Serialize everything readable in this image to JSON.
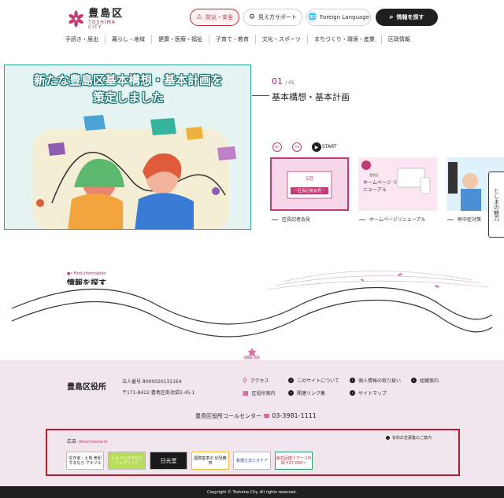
{
  "header": {
    "logo_jp": "豊島区",
    "logo_en": "TOSHIMA CITY",
    "buttons": {
      "disaster": "防災・安全",
      "support": "見え方サポート",
      "language": "Foreign Language",
      "find": "情報を探す"
    },
    "nav": [
      "手続き・届出",
      "暮らし・地域",
      "健康・医療・福祉",
      "子育て・教育",
      "文化・スポーツ",
      "まちづくり・環境・産業",
      "区政情報"
    ]
  },
  "hero": {
    "title_line1": "新たな豊島区基本構想・基本計画を",
    "title_line2": "策定しました",
    "slide_current": "01",
    "slide_total": "/ 05",
    "slide_title": "基本構想・基本計画",
    "start_label": "START"
  },
  "thumbnails": [
    {
      "caption": "区長記者会見",
      "text_top": "5月",
      "text_bottom": "ー区長記者会見ー"
    },
    {
      "caption": "ホームページリニューアル",
      "text_top": "豊島区",
      "text_bottom": "ホームページ リニューアル"
    },
    {
      "caption": "熱中症対策",
      "text_top": "",
      "text_bottom": ""
    }
  ],
  "side_banner": "としまの魅力",
  "find_info": {
    "label": "Find information",
    "title": "情報を探す"
  },
  "pagetop": "PAGE TOP",
  "footer": {
    "org_name": "豊島区役所",
    "corp_number": "法人番号 8000020131164",
    "address": "〒171-8422 豊島区南池袋2-45-1",
    "links": {
      "access": "アクセス",
      "about": "このサイトについて",
      "privacy": "個人情報の取り扱い",
      "mobile": "組織案内",
      "guide": "区役所案内",
      "related": "関連リンク集",
      "sitemap": "サイトマップ"
    },
    "call_center": "豊島区役所コールセンター",
    "tel": "03-3981-1111"
  },
  "ads": {
    "label": "広告",
    "label_en": "Advertisement",
    "recruit": "有料広告募集のご案内",
    "items": [
      "空き家・土地 売却するなら アキソル",
      "シェアハウスなら シェアリーフ",
      "日光堂",
      "国際基準の 幼児教育",
      "税理士法人ガイア",
      "疲労回復ツアー 2日間 ¥27,000〜"
    ]
  },
  "copyright": "Copyright © Toshima City. All rights reserved."
}
